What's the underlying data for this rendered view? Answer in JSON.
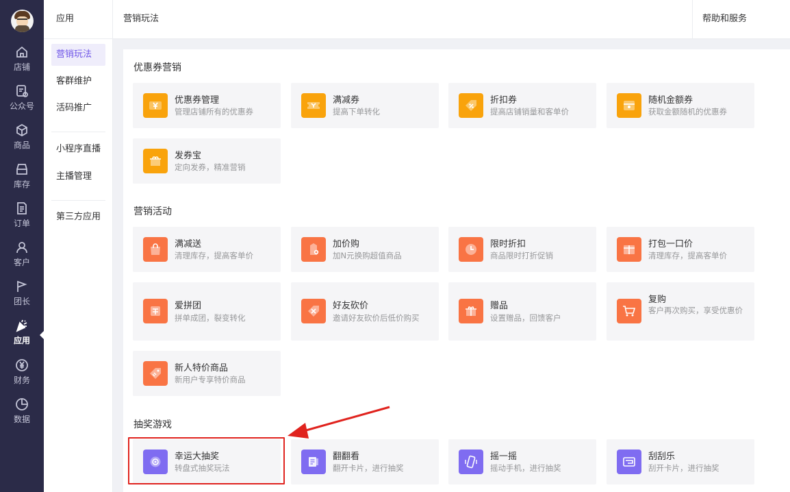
{
  "sidebar": {
    "items": [
      {
        "label": "店铺",
        "icon": "home-icon"
      },
      {
        "label": "公众号",
        "icon": "wechat-account-icon"
      },
      {
        "label": "商品",
        "icon": "box-icon"
      },
      {
        "label": "库存",
        "icon": "inventory-icon"
      },
      {
        "label": "订单",
        "icon": "order-icon"
      },
      {
        "label": "客户",
        "icon": "customer-icon"
      },
      {
        "label": "团长",
        "icon": "flag-icon"
      },
      {
        "label": "应用",
        "icon": "party-popper-icon",
        "active": true
      },
      {
        "label": "财务",
        "icon": "yen-icon"
      },
      {
        "label": "数据",
        "icon": "pie-chart-icon"
      }
    ]
  },
  "submenu": {
    "title": "应用",
    "items": [
      {
        "label": "营销玩法",
        "active": true
      },
      {
        "label": "客群维护"
      },
      {
        "label": "活码推广"
      },
      {
        "label": "小程序直播"
      },
      {
        "label": "主播管理"
      },
      {
        "label": "第三方应用"
      }
    ]
  },
  "header": {
    "title": "营销玩法",
    "help": "帮助和服务"
  },
  "sections": [
    {
      "title": "优惠券营销",
      "cards": [
        {
          "name": "优惠券管理",
          "desc": "管理店铺所有的优惠券",
          "icon": "coupon-yen-icon",
          "color": "#f9a30c"
        },
        {
          "name": "满减券",
          "desc": "提高下单转化",
          "icon": "ticket-icon",
          "color": "#f9a30c"
        },
        {
          "name": "折扣券",
          "desc": "提高店铺销量和客单价",
          "icon": "percent-tag-icon",
          "color": "#f9a30c"
        },
        {
          "name": "随机金额券",
          "desc": "获取金额随机的优惠券",
          "icon": "random-coupon-icon",
          "color": "#f9a30c"
        },
        {
          "name": "发券宝",
          "desc": "定向发券，精准营销",
          "icon": "gift-box-icon",
          "color": "#f9a30c"
        }
      ]
    },
    {
      "title": "营销活动",
      "cards": [
        {
          "name": "满减送",
          "desc": "清理库存，提高客单价",
          "icon": "shopping-bag-icon",
          "color": "#f97444"
        },
        {
          "name": "加价购",
          "desc": "加N元换购超值商品",
          "icon": "add-price-tag-icon",
          "color": "#f97444"
        },
        {
          "name": "限时折扣",
          "desc": "商品限时打折促销",
          "icon": "clock-icon",
          "color": "#f97444"
        },
        {
          "name": "打包一口价",
          "desc": "清理库存，提高客单价",
          "icon": "package-icon",
          "color": "#f97444"
        },
        {
          "name": "爱拼团",
          "desc": "拼单成团，裂变转化",
          "icon": "group-buy-icon",
          "color": "#f97444"
        },
        {
          "name": "好友砍价",
          "desc": "邀请好友砍价后低价购买",
          "icon": "bargain-icon",
          "color": "#f97444"
        },
        {
          "name": "赠品",
          "desc": "设置赠品，回馈客户",
          "icon": "present-icon",
          "color": "#f97444"
        },
        {
          "name": "复购",
          "desc": "客户再次购买，享受优惠价",
          "icon": "cart-icon",
          "color": "#f97444"
        },
        {
          "name": "新人特价商品",
          "desc": "新用户专享特价商品",
          "icon": "price-tag-icon",
          "color": "#f97444"
        }
      ]
    },
    {
      "title": "抽奖游戏",
      "cards": [
        {
          "name": "幸运大抽奖",
          "desc": "转盘式抽奖玩法",
          "icon": "wheel-icon",
          "color": "#7f6cf1"
        },
        {
          "name": "翻翻看",
          "desc": "翻开卡片，进行抽奖",
          "icon": "flip-card-icon",
          "color": "#7f6cf1"
        },
        {
          "name": "摇一摇",
          "desc": "摇动手机，进行抽奖",
          "icon": "shake-phone-icon",
          "color": "#7f6cf1"
        },
        {
          "name": "刮刮乐",
          "desc": "刮开卡片，进行抽奖",
          "icon": "scratch-card-icon",
          "color": "#7f6cf1"
        }
      ]
    }
  ],
  "annotation": {
    "color": "#e0231e"
  }
}
